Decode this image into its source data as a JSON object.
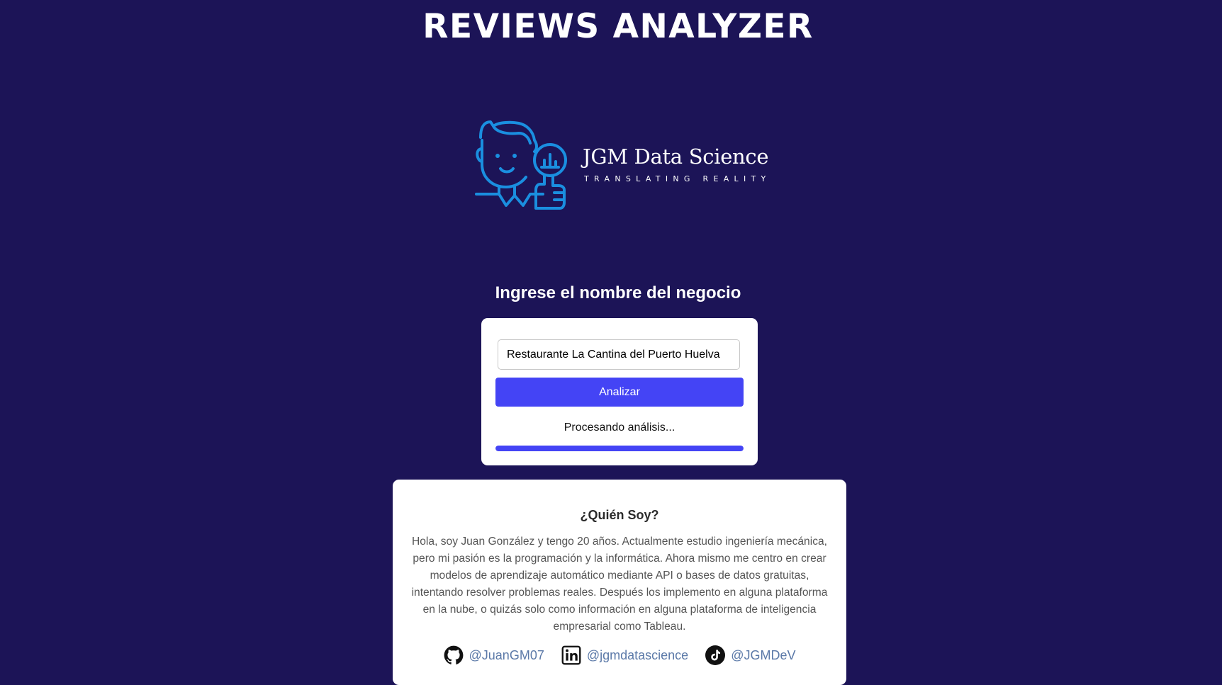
{
  "app": {
    "title": "REVIEWS ANALYZER"
  },
  "logo": {
    "icon": "analyst-thumbs-up-icon",
    "brand": "JGM Data Science",
    "tagline": "TRANSLATING REALITY",
    "color": "#1a8fe0"
  },
  "search": {
    "heading": "Ingrese el nombre del negocio",
    "input_value": "Restaurante La Cantina del Puerto Huelva",
    "placeholder": "",
    "button_label": "Analizar",
    "status": "Procesando análisis...",
    "progress": 1.0
  },
  "about": {
    "title": "¿Quién Soy?",
    "text": "Hola, soy Juan González y tengo 20 años. Actualmente estudio ingeniería mecánica, pero mi pasión es la programación y la informática. Ahora mismo me centro en crear modelos de aprendizaje automático mediante API o bases de datos gratuitas, intentando resolver problemas reales. Después los implemento en alguna plataforma en la nube, o quizás solo como información en alguna plataforma de inteligencia empresarial como Tableau.",
    "socials": [
      {
        "icon": "github-icon",
        "handle": "@JuanGM07"
      },
      {
        "icon": "linkedin-icon",
        "handle": "@jgmdatascience"
      },
      {
        "icon": "tiktok-icon",
        "handle": "@JGMDeV"
      }
    ]
  },
  "colors": {
    "background": "#1c1457",
    "accent": "#4444f5",
    "link": "#5b79a8"
  }
}
